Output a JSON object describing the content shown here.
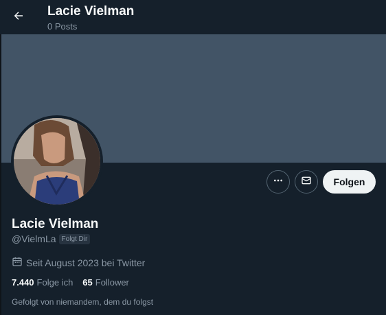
{
  "header": {
    "title": "Lacie Vielman",
    "subtitle": "0 Posts",
    "back_icon": "arrow-left-icon"
  },
  "profile": {
    "display_name": "Lacie Vielman",
    "handle": "@VielmLa",
    "follows_you_badge": "Folgt Dir",
    "joined": "Seit August 2023 bei Twitter",
    "following_count": "7.440",
    "following_label": "Folge ich",
    "followers_count": "65",
    "followers_label": "Follower",
    "followed_by_text": "Gefolgt von niemandem, dem du folgst"
  },
  "actions": {
    "more_icon": "more-icon",
    "message_icon": "mail-icon",
    "follow_label": "Folgen"
  },
  "colors": {
    "background": "#15202b",
    "banner": "#425466",
    "secondary_text": "#8b98a5",
    "follow_button_bg": "#eff3f4"
  }
}
